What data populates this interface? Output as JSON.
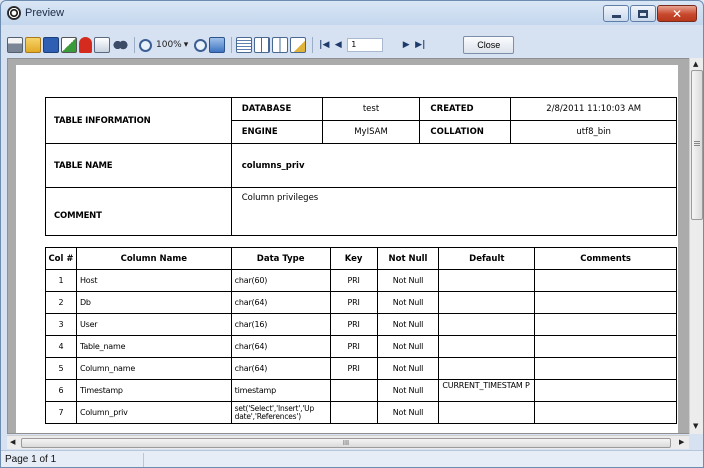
{
  "window": {
    "title": "Preview"
  },
  "toolbar": {
    "icons": [
      "print-icon",
      "open-folder-icon",
      "save-icon",
      "export-icon",
      "pdf-icon",
      "page-setup-icon",
      "find-icon",
      "zoom-in-icon",
      "zoom-out-icon",
      "fit-page-icon",
      "single-page-icon",
      "multi-page-icon",
      "book-icon",
      "edit-icon"
    ],
    "zoom_value": "100%",
    "page_number": "1",
    "close_label": "Close"
  },
  "info": {
    "table_information_label": "TABLE INFORMATION",
    "database_label": "DATABASE",
    "database_value": "test",
    "created_label": "CREATED",
    "created_value": "2/8/2011 11:10:03 AM",
    "engine_label": "ENGINE",
    "engine_value": "MyISAM",
    "collation_label": "COLLATION",
    "collation_value": "utf8_bin",
    "table_name_label": "TABLE NAME",
    "table_name_value": "columns_priv",
    "comment_label": "COMMENT",
    "comment_value": "Column privileges"
  },
  "columns": {
    "headers": [
      "Col #",
      "Column Name",
      "Data Type",
      "Key",
      "Not Null",
      "Default",
      "Comments"
    ],
    "rows": [
      {
        "num": "1",
        "name": "Host",
        "type": "char(60)",
        "key": "PRI",
        "not_null": "Not Null",
        "default": "",
        "comments": ""
      },
      {
        "num": "2",
        "name": "Db",
        "type": "char(64)",
        "key": "PRI",
        "not_null": "Not Null",
        "default": "",
        "comments": ""
      },
      {
        "num": "3",
        "name": "User",
        "type": "char(16)",
        "key": "PRI",
        "not_null": "Not Null",
        "default": "",
        "comments": ""
      },
      {
        "num": "4",
        "name": "Table_name",
        "type": "char(64)",
        "key": "PRI",
        "not_null": "Not Null",
        "default": "",
        "comments": ""
      },
      {
        "num": "5",
        "name": "Column_name",
        "type": "char(64)",
        "key": "PRI",
        "not_null": "Not Null",
        "default": "",
        "comments": ""
      },
      {
        "num": "6",
        "name": "Timestamp",
        "type": "timestamp",
        "key": "",
        "not_null": "Not Null",
        "default": "CURRENT_TIMESTAM P",
        "comments": ""
      },
      {
        "num": "7",
        "name": "Column_priv",
        "type": "set('Select','Insert','Up date','References')",
        "key": "",
        "not_null": "Not Null",
        "default": "",
        "comments": ""
      }
    ]
  },
  "hscroll_label": "III",
  "status": {
    "page_text": "Page 1 of 1"
  }
}
